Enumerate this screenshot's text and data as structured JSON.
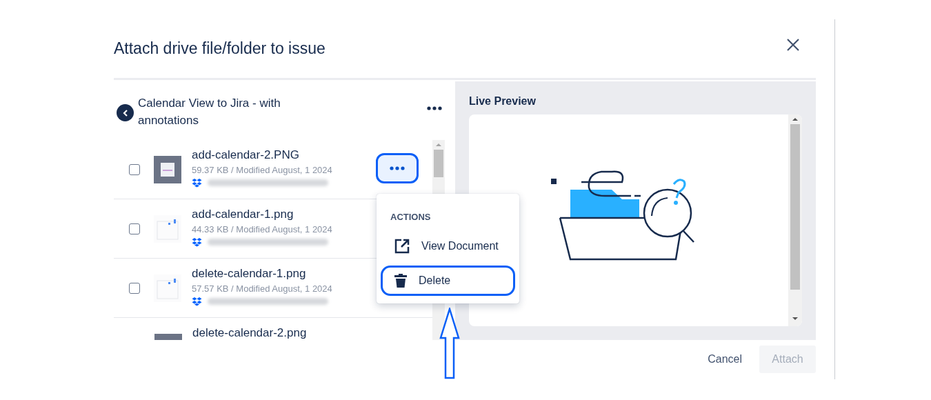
{
  "dialog": {
    "title": "Attach drive file/folder to issue"
  },
  "folder": {
    "title": "Calendar View to Jira - with annotations"
  },
  "files": [
    {
      "name": "add-calendar-2.PNG",
      "meta": "59.37 KB / Modified August, 1 2024",
      "checked": false,
      "kind": "dark",
      "menu_open": true
    },
    {
      "name": "add-calendar-1.png",
      "meta": "44.33 KB / Modified August, 1 2024",
      "checked": false,
      "kind": "light",
      "menu_open": false
    },
    {
      "name": "delete-calendar-1.png",
      "meta": "57.57 KB / Modified August, 1 2024",
      "checked": false,
      "kind": "light",
      "menu_open": false
    },
    {
      "name": "delete-calendar-2.png",
      "kind": "dark",
      "menu_open": false
    }
  ],
  "menu": {
    "heading": "ACTIONS",
    "items": [
      {
        "label": "View Document",
        "kind": "external",
        "highlighted": false
      },
      {
        "label": "Delete",
        "kind": "trash",
        "highlighted": true
      }
    ]
  },
  "preview": {
    "title": "Live Preview"
  },
  "footer": {
    "cancel": "Cancel",
    "attach": {
      "label": "Attach",
      "disabled": true
    }
  }
}
